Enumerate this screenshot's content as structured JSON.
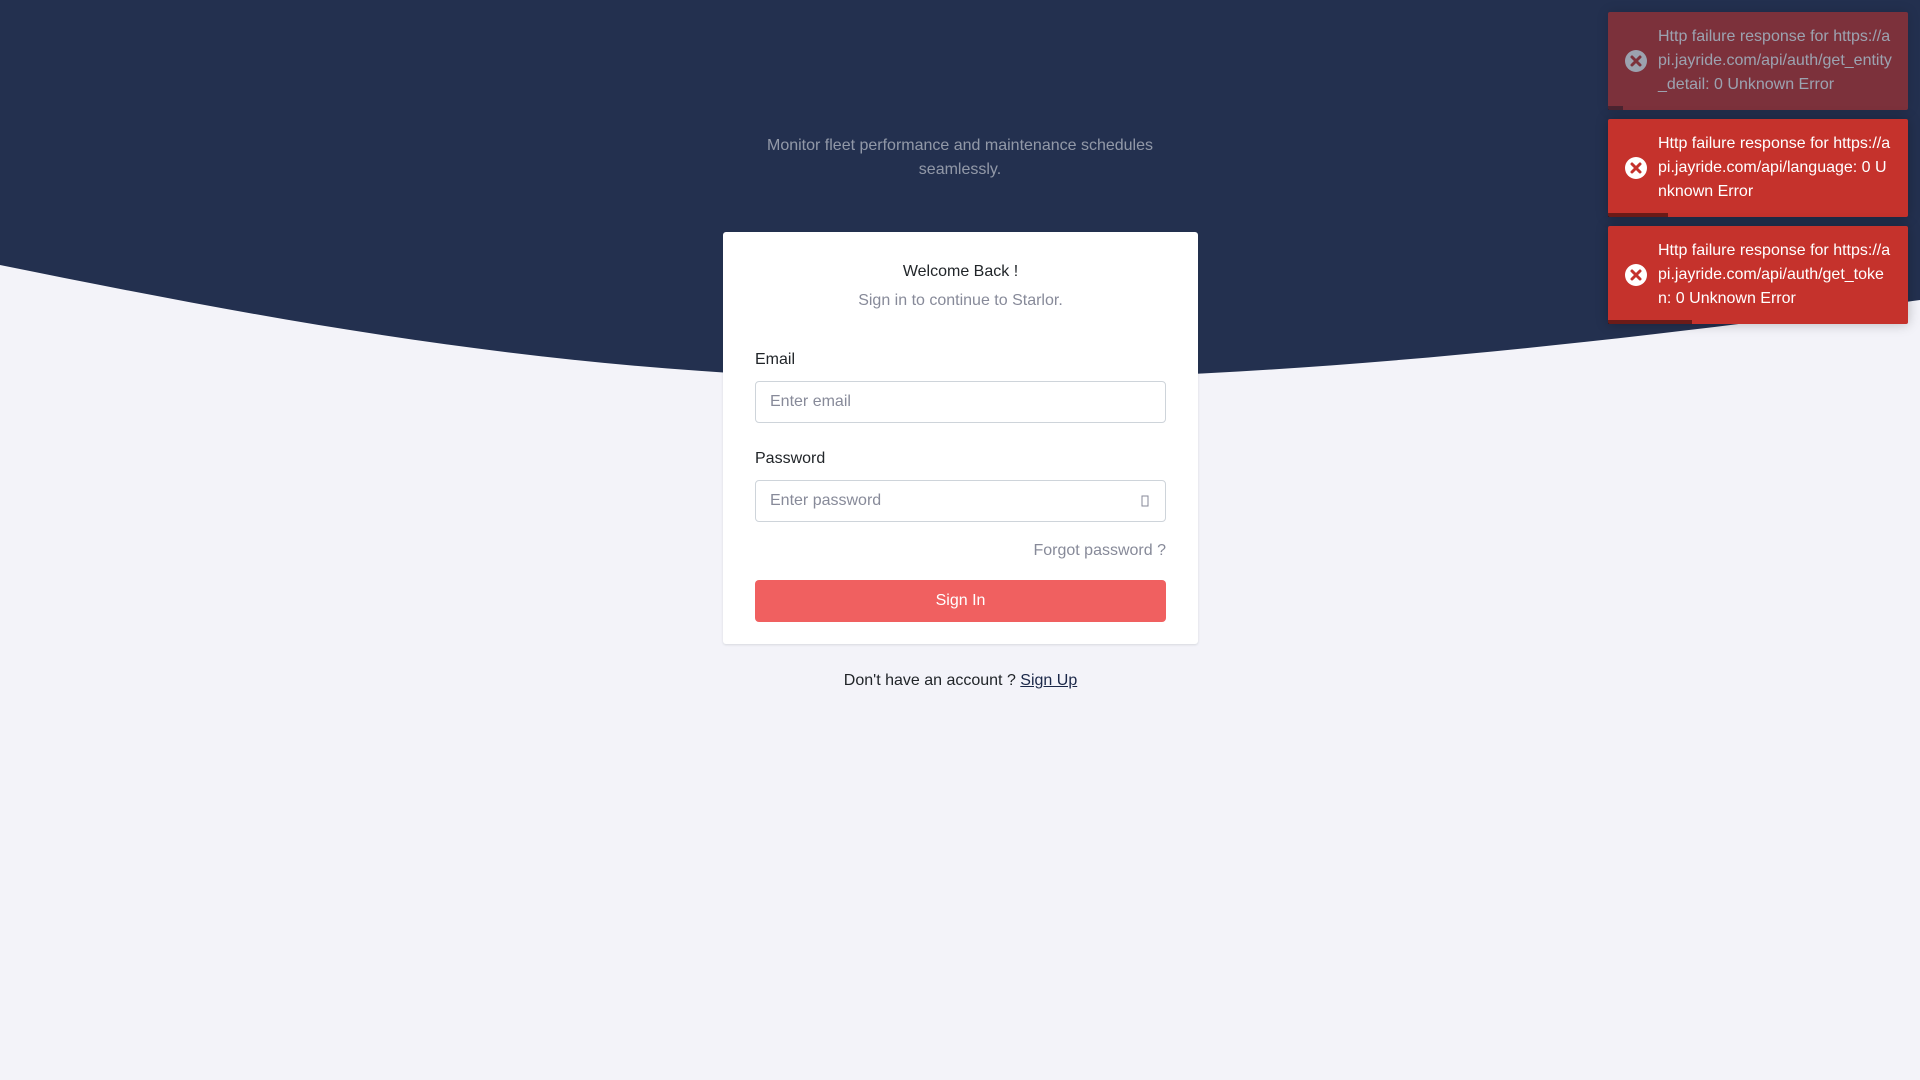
{
  "hero": {
    "tagline": "Monitor fleet performance and maintenance schedules seamlessly.",
    "background_color": "#23304f",
    "page_background": "#f3f3f9"
  },
  "card": {
    "welcome": "Welcome Back !",
    "subtitle": "Sign in to continue to Starlor."
  },
  "form": {
    "email_label": "Email",
    "email_placeholder": "Enter email",
    "email_value": "",
    "password_label": "Password",
    "password_placeholder": "Enter password",
    "password_value": "",
    "password_toggle_icon": "eye-icon",
    "forgot_password": "Forgot password ?",
    "sign_in": "Sign In",
    "sign_in_color": "#f06060"
  },
  "footer": {
    "prompt": "Don't have an account ? ",
    "signup_link": "Sign Up"
  },
  "toasts": [
    {
      "message": "Http failure response for https://api.jayride.com/api/auth/get_entity_detail: 0 Unknown Error",
      "icon": "error-icon",
      "faded": true,
      "progress": 0.05
    },
    {
      "message": "Http failure response for https://api.jayride.com/api/language: 0 Unknown Error",
      "icon": "error-icon",
      "faded": false,
      "progress": 0.2
    },
    {
      "message": "Http failure response for https://api.jayride.com/api/auth/get_token: 0 Unknown Error",
      "icon": "error-icon",
      "faded": false,
      "progress": 0.28
    }
  ],
  "toast_color": "#c5322c"
}
